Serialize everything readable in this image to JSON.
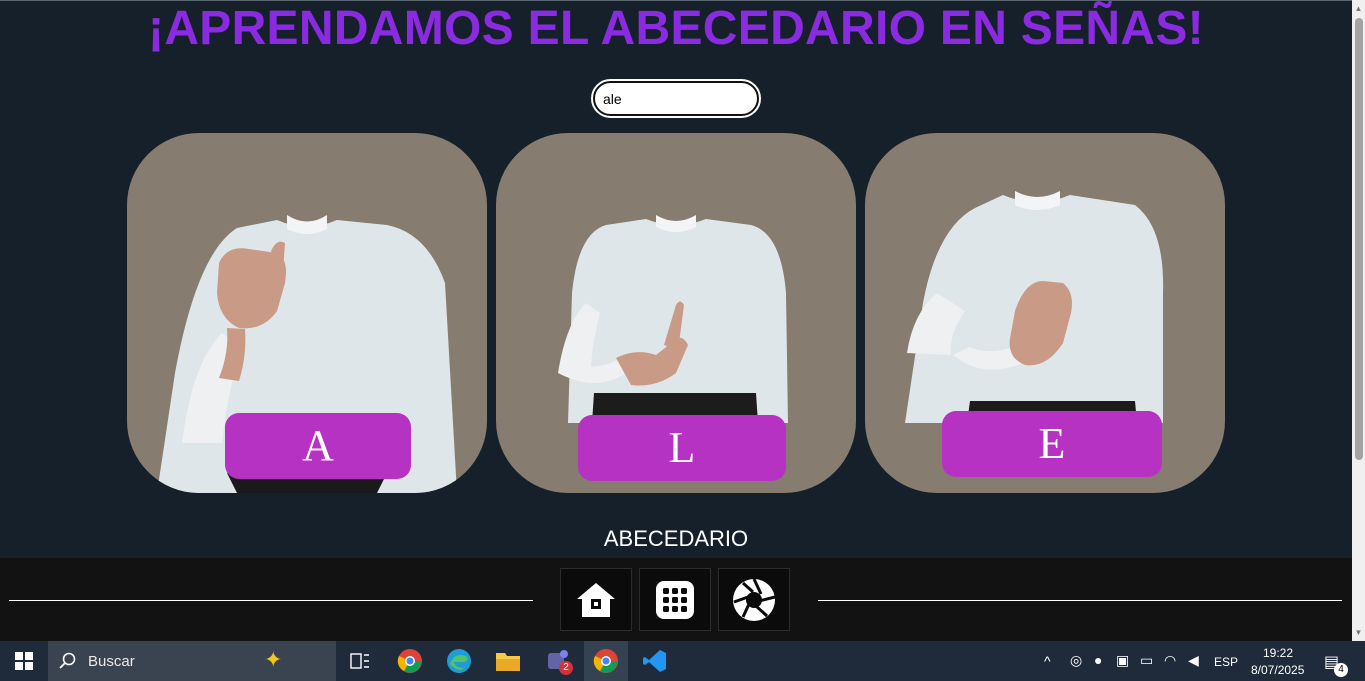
{
  "page": {
    "title": "¡APRENDAMOS EL ABECEDARIO EN SEÑAS!",
    "search": {
      "value": "ale",
      "placeholder": ""
    },
    "cards": [
      {
        "letter": "A"
      },
      {
        "letter": "L"
      },
      {
        "letter": "E"
      }
    ],
    "section_label": "ABECEDARIO",
    "nav": [
      {
        "icon": "home-icon"
      },
      {
        "icon": "grid-icon"
      },
      {
        "icon": "camera-shutter-icon"
      }
    ],
    "colors": {
      "accent": "#8a2be2",
      "badge": "#b632c2",
      "background": "#16202a",
      "card": "#877c70"
    }
  },
  "taskbar": {
    "search_label": "Buscar",
    "teams_badge": "2",
    "language": "ESP",
    "time": "19:22",
    "date": "8/07/2025",
    "notifications": "4"
  }
}
